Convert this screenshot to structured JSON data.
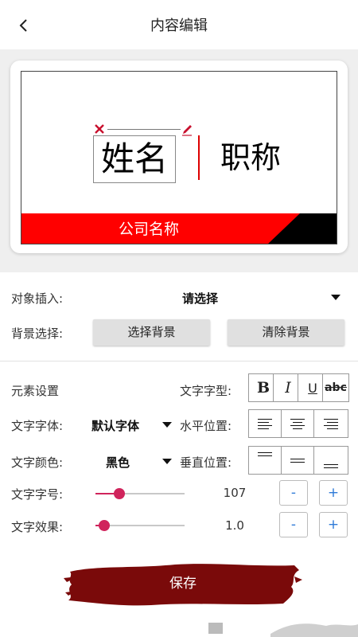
{
  "header": {
    "title": "内容编辑",
    "back_icon": "chevron-left-icon"
  },
  "card": {
    "name": "姓名",
    "job_title": "职称",
    "company": "公司名称",
    "colors": {
      "accent": "#ff0000",
      "divider": "#dd0000",
      "dark": "#000000"
    }
  },
  "insert": {
    "label": "对象插入:",
    "value": "请选择"
  },
  "background": {
    "label": "背景选择:",
    "choose": "选择背景",
    "clear": "清除背景"
  },
  "element": {
    "section_label": "元素设置",
    "style_label": "文字字型:",
    "style_buttons": [
      "B",
      "I",
      "U",
      "abc"
    ],
    "font_label": "文字字体:",
    "font_value": "默认字体",
    "halign_label": "水平位置:",
    "color_label": "文字颜色:",
    "color_value": "黑色",
    "valign_label": "垂直位置:",
    "size_label": "文字字号:",
    "size_value": "107",
    "size_fraction": 0.27,
    "effect_label": "文字效果:",
    "effect_value": "1.0",
    "effect_fraction": 0.1,
    "minus": "-",
    "plus": "+",
    "accent": "#d0245c",
    "stepper_color": "#2f7bd8"
  },
  "save": {
    "label": "保存",
    "color": "#7a0a0a"
  }
}
